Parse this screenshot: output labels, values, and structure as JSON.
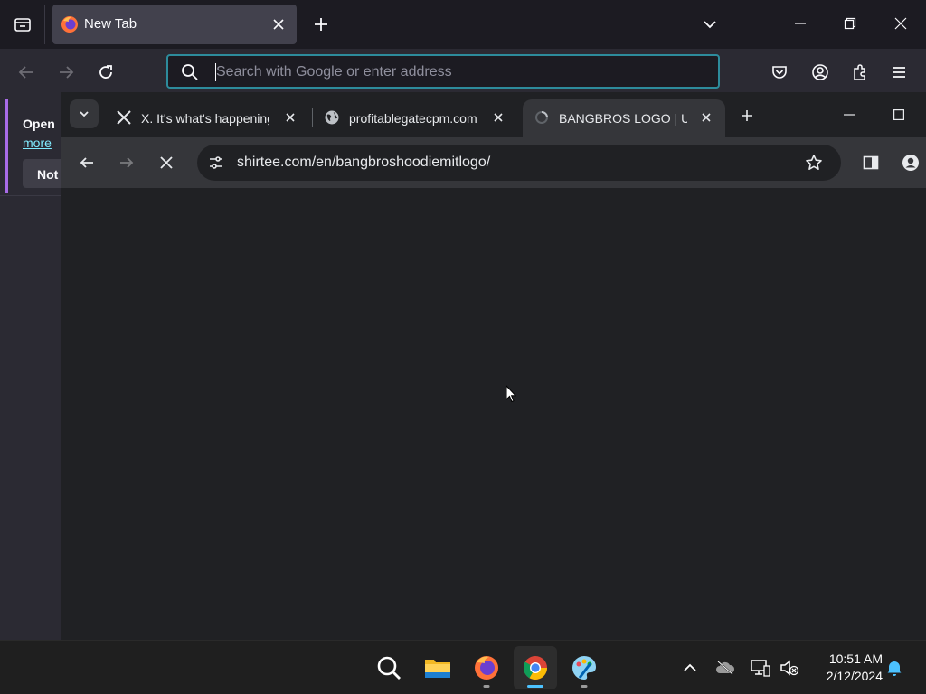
{
  "firefox": {
    "tab": {
      "title": "New Tab"
    },
    "urlbar": {
      "placeholder": "Search with Google or enter address"
    },
    "notice": {
      "heading": "Open",
      "link": "more",
      "button": "Not"
    }
  },
  "chrome": {
    "tabs": [
      {
        "title": "X. It's what's happening",
        "favicon": "x-logo-icon"
      },
      {
        "title": "profitablegatecpm.com",
        "favicon": "globe-icon"
      },
      {
        "title": "BANGBROS LOGO | Unisex",
        "favicon": "loading-spinner-icon",
        "active": true
      }
    ],
    "omnibox": {
      "url": "shirtee.com/en/bangbroshoodiemitlogo/"
    }
  },
  "taskbar": {
    "apps": [
      "search-icon",
      "file-explorer-icon",
      "firefox-icon",
      "chrome-icon",
      "paint-icon"
    ],
    "clock": {
      "time": "10:51 AM",
      "date": "2/12/2024"
    }
  },
  "colors": {
    "firefox_bg": "#1c1b22",
    "firefox_toolbar": "#2b2a33",
    "chrome_bg": "#202124",
    "chrome_toolbar": "#35363a",
    "accent": "#4cc2ff",
    "notice_accent": "#a86be8"
  }
}
